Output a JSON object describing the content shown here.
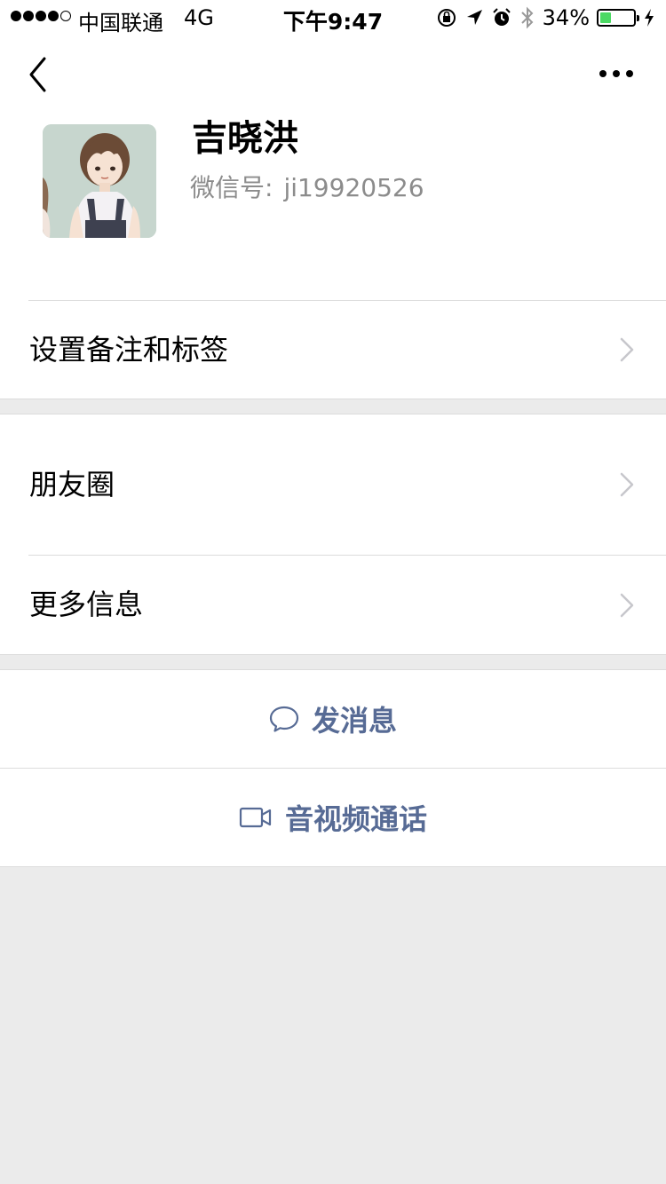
{
  "status_bar": {
    "carrier": "中国联通",
    "network": "4G",
    "time": "下午9:47",
    "battery_percent": "34%",
    "battery_level": 0.34,
    "battery_color": "#4cd964",
    "icons": [
      "signal-dots",
      "orientation-lock-icon",
      "location-arrow-icon",
      "alarm-icon",
      "bluetooth-icon",
      "battery-icon",
      "charging-bolt-icon"
    ]
  },
  "nav": {
    "back_icon": "chevron-left-icon",
    "more_icon": "ellipsis-icon"
  },
  "profile": {
    "name": "吉晓洪",
    "wechat_id_label": "微信号:",
    "wechat_id": "ji19920526"
  },
  "list": {
    "remarks_tags": "设置备注和标签",
    "moments": "朋友圈",
    "more_info": "更多信息"
  },
  "actions": {
    "send_message": "发消息",
    "video_call": "音视频通话",
    "accent_color": "#576b95"
  }
}
